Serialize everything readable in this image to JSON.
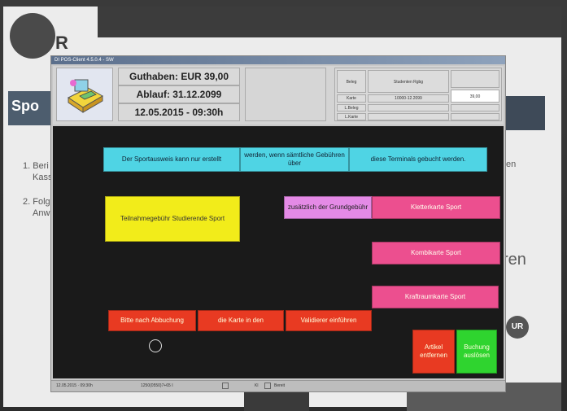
{
  "background": {
    "logo_text": "R",
    "banner_text": "Spo",
    "list_items": [
      "1. Beri",
      "Kass",
      "2. Folg",
      "Anw"
    ],
    "right_texts": [
      "en",
      "ren"
    ],
    "badge_text": "UR"
  },
  "window": {
    "title": "DI POS-Client 4.5.0.4 - SW"
  },
  "header": {
    "guthaben": "Guthaben:  EUR 39,00",
    "ablauf": "Ablauf:  31.12.2099",
    "datetime": "12.05.2015 - 09:30h",
    "beleg_panel": {
      "beleg_label": "Beleg",
      "beleg_value": "Studenten Rgbg",
      "karte_label": "Karte",
      "karte_value": "10000-12.2099",
      "karte_amount": "39,00",
      "row3_label": "L.Beleg",
      "row4_label": "L.Karte"
    }
  },
  "buttons": {
    "info1": "Der Sportausweis kann nur erstellt",
    "info2": "werden, wenn sämtliche Gebühren über",
    "info3": "diese Terminals gebucht werden.",
    "teilnahme": "Teilnahmegebühr Studierende Sport",
    "zusaetzlich": "zusätzlich der Grundgebühr",
    "kletter": "Kletterkarte Sport",
    "kombi": "Kombikarte Sport",
    "kraft": "Kraftraumkarte Sport",
    "hint1": "Bitte nach Abbuchung",
    "hint2": "die Karte in den",
    "hint3": "Validierer einführen",
    "artikel": "Artikel entfernen",
    "buchung": "Buchung auslösen"
  },
  "statusbar": {
    "datetime": "12.05.2015 · 09:30h",
    "id": "1250(0550)7+65 I",
    "kl": "Kl",
    "bereit": "Bereit"
  },
  "colors": {
    "cyan": "#4fd4e4",
    "yellow": "#f2ec1a",
    "pink": "#ec4f8f",
    "lilac": "#e48ae6",
    "red": "#e83a22",
    "green": "#2fd42f"
  }
}
